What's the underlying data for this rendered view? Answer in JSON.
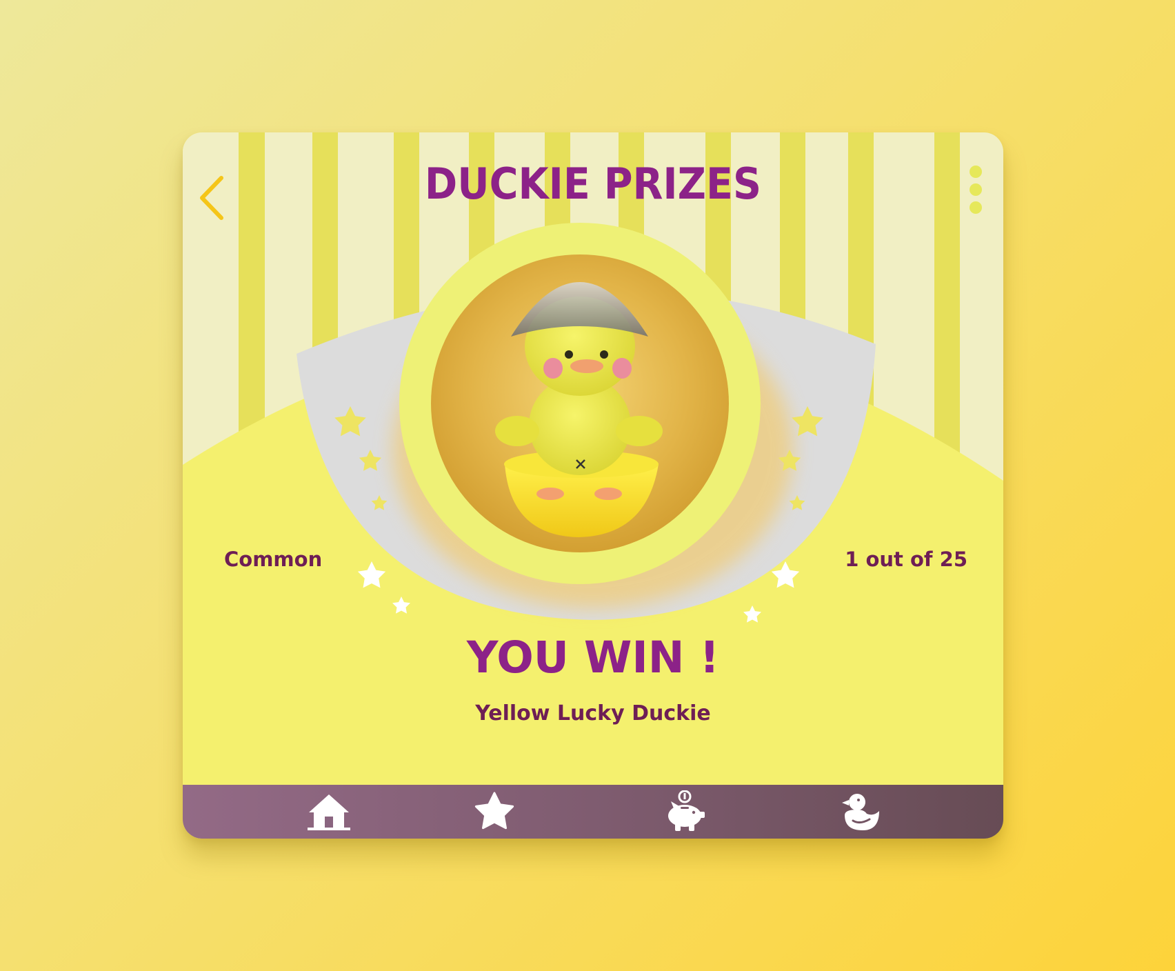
{
  "header": {
    "title": "DUCKIE PRIZES"
  },
  "prize": {
    "rarity": "Common",
    "count_text": "1 out of 25",
    "headline": "YOU WIN !",
    "name": "Yellow Lucky Duckie"
  },
  "nav": {
    "items": [
      {
        "icon": "home-icon"
      },
      {
        "icon": "star-icon"
      },
      {
        "icon": "piggy-bank-icon"
      },
      {
        "icon": "duck-icon"
      }
    ]
  },
  "colors": {
    "accent": "#8c2288",
    "text_dark": "#6e1e55",
    "back_arrow": "#f5c518",
    "menu_dots": "#e6e85a",
    "navbar": "#7f5c70"
  }
}
